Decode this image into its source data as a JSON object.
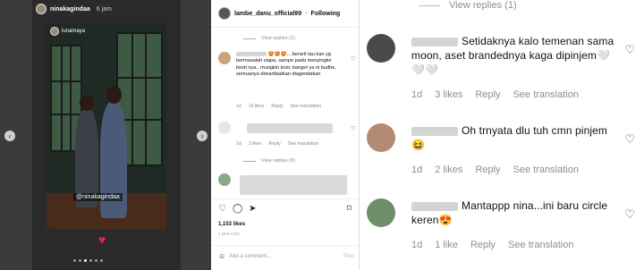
{
  "story": {
    "username": "ninakagindaa",
    "time": "6 jam",
    "photo_username": "lunamaya",
    "photo_tag": "@ninakagindaa"
  },
  "post": {
    "username": "lambe_danu_official99",
    "follow_label": "Following",
    "comments": [
      {
        "text": "🤩🤩🤩... berarti tau kan yg bermasalah siapa, sampe pada menyingkir besti nya.. mungkin toxic banget ya ni budhe, semuanya dimanfaatkan diagendakan",
        "time": "1d",
        "likes": "16 likes",
        "reply": "Reply",
        "see_translation": "See translation"
      },
      {
        "time": "1d",
        "likes": "2 likes",
        "reply": "Reply",
        "see_translation": "See translation"
      }
    ],
    "view_replies_1": "View replies (1)",
    "view_replies_9": "View replies (9)",
    "likes_count": "1,153 likes",
    "time_ago": "1 DAY AGO",
    "add_comment_placeholder": "Add a comment...",
    "post_button": "Post"
  },
  "zoom": {
    "view_replies": "View replies (1)",
    "comments": [
      {
        "text": "Setidaknya kalo temenan sama moon, aset brandednya kaga dipinjem🤍🤍🤍",
        "time": "1d",
        "likes": "3 likes",
        "reply": "Reply",
        "see_translation": "See translation"
      },
      {
        "text": "Oh trnyata dlu tuh cmn pinjem😆",
        "time": "1d",
        "likes": "2 likes",
        "reply": "Reply",
        "see_translation": "See translation"
      },
      {
        "text": "Mantappp nina...ini baru circle keren😍",
        "time": "1d",
        "likes": "1 like",
        "reply": "Reply",
        "see_translation": "See translation"
      }
    ]
  },
  "colors": {
    "story_bg": "#3b3b3b",
    "heart_red": "#e0245e",
    "post_blue": "#9bc4f3",
    "meta_gray": "#8e8e8e"
  }
}
